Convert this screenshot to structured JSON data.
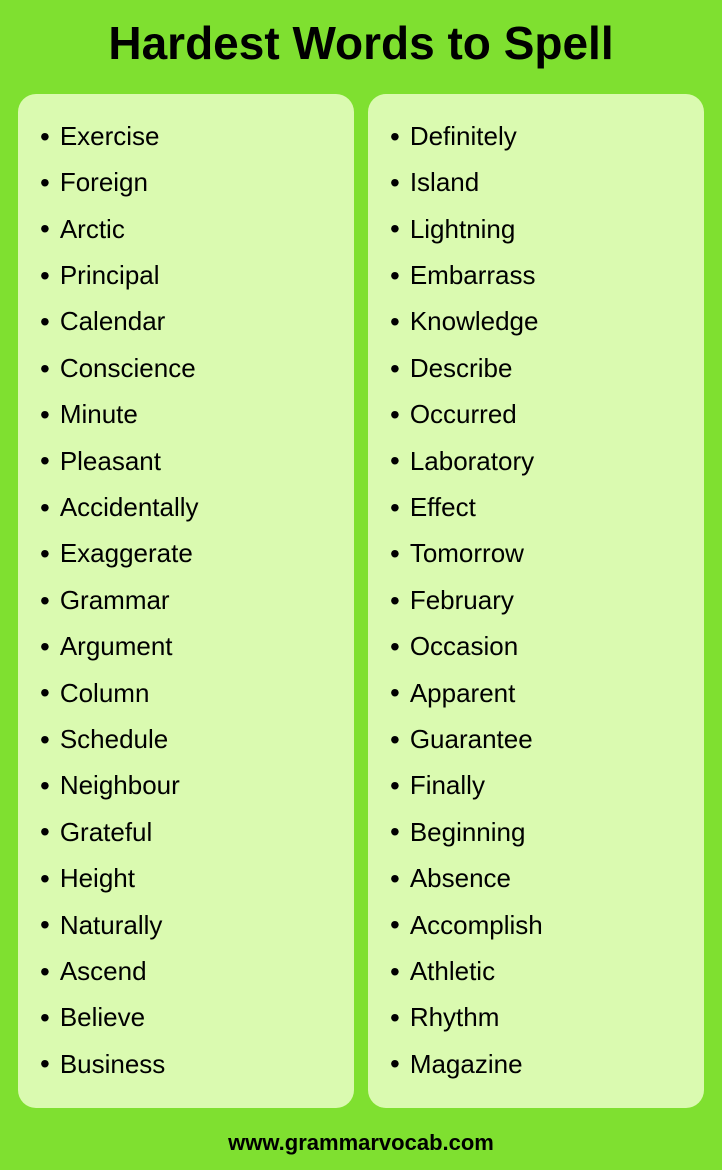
{
  "header": {
    "title": "Hardest Words to Spell"
  },
  "left_column": {
    "words": [
      "Exercise",
      "Foreign",
      "Arctic",
      "Principal",
      "Calendar",
      "Conscience",
      "Minute",
      "Pleasant",
      "Accidentally",
      "Exaggerate",
      "Grammar",
      "Argument",
      "Column",
      "Schedule",
      "Neighbour",
      "Grateful",
      "Height",
      "Naturally",
      "Ascend",
      "Believe",
      "Business"
    ]
  },
  "right_column": {
    "words": [
      "Definitely",
      "Island",
      "Lightning",
      "Embarrass",
      "Knowledge",
      "Describe",
      "Occurred",
      "Laboratory",
      "Effect",
      "Tomorrow",
      "February",
      "Occasion",
      "Apparent",
      "Guarantee",
      "Finally",
      "Beginning",
      "Absence",
      "Accomplish",
      "Athletic",
      "Rhythm",
      "Magazine"
    ]
  },
  "footer": {
    "url": "www.grammarvocab.com"
  }
}
